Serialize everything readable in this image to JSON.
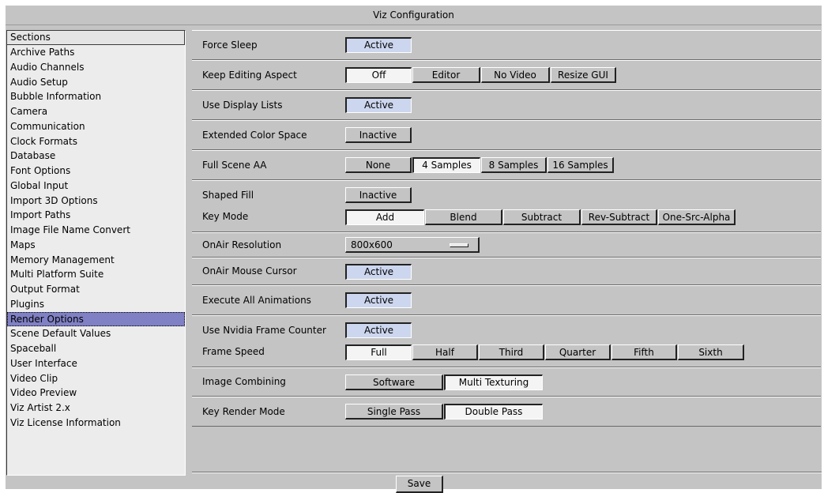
{
  "window": {
    "title": "Viz Configuration"
  },
  "sidebar": {
    "header": "Sections",
    "items": [
      {
        "label": "Archive Paths"
      },
      {
        "label": "Audio Channels"
      },
      {
        "label": "Audio Setup"
      },
      {
        "label": "Bubble Information"
      },
      {
        "label": "Camera"
      },
      {
        "label": "Communication"
      },
      {
        "label": "Clock Formats"
      },
      {
        "label": "Database"
      },
      {
        "label": "Font Options"
      },
      {
        "label": "Global Input"
      },
      {
        "label": "Import 3D Options"
      },
      {
        "label": "Import Paths"
      },
      {
        "label": "Image File Name Convert"
      },
      {
        "label": "Maps"
      },
      {
        "label": "Memory Management"
      },
      {
        "label": "Multi Platform Suite"
      },
      {
        "label": "Output Format"
      },
      {
        "label": "Plugins"
      },
      {
        "label": "Render Options",
        "selected": true
      },
      {
        "label": "Scene Default Values"
      },
      {
        "label": "Spaceball"
      },
      {
        "label": "User Interface"
      },
      {
        "label": "Video Clip"
      },
      {
        "label": "Video Preview"
      },
      {
        "label": "Viz Artist 2.x"
      },
      {
        "label": "Viz License Information"
      }
    ]
  },
  "settings": {
    "force_sleep": {
      "label": "Force Sleep",
      "value": "Active"
    },
    "keep_editing_aspect": {
      "label": "Keep Editing Aspect",
      "options": [
        "Off",
        "Editor",
        "No Video",
        "Resize GUI"
      ],
      "selected": "Off"
    },
    "use_display_lists": {
      "label": "Use Display Lists",
      "value": "Active"
    },
    "extended_color_space": {
      "label": "Extended Color Space",
      "value": "Inactive"
    },
    "full_scene_aa": {
      "label": "Full Scene AA",
      "options": [
        "None",
        "4 Samples",
        "8 Samples",
        "16 Samples"
      ],
      "selected": "4 Samples"
    },
    "shaped_fill": {
      "label": "Shaped Fill",
      "value": "Inactive"
    },
    "key_mode": {
      "label": "Key Mode",
      "options": [
        "Add",
        "Blend",
        "Subtract",
        "Rev-Subtract",
        "One-Src-Alpha"
      ],
      "selected": "Add"
    },
    "onair_resolution": {
      "label": "OnAir Resolution",
      "value": "800x600"
    },
    "onair_mouse_cursor": {
      "label": "OnAir Mouse Cursor",
      "value": "Active"
    },
    "execute_all_animations": {
      "label": "Execute All Animations",
      "value": "Active"
    },
    "use_nvidia_frame_counter": {
      "label": "Use Nvidia Frame Counter",
      "value": "Active"
    },
    "frame_speed": {
      "label": "Frame Speed",
      "options": [
        "Full",
        "Half",
        "Third",
        "Quarter",
        "Fifth",
        "Sixth"
      ],
      "selected": "Full"
    },
    "image_combining": {
      "label": "Image Combining",
      "options": [
        "Software",
        "Multi Texturing"
      ],
      "selected": "Multi Texturing"
    },
    "key_render_mode": {
      "label": "Key Render Mode",
      "options": [
        "Single Pass",
        "Double Pass"
      ],
      "selected": "Double Pass"
    }
  },
  "footer": {
    "save_label": "Save"
  },
  "colors": {
    "background": "#c4c4c4",
    "active_toggle": "#ccd6ee",
    "selected_item": "#8080c4"
  }
}
